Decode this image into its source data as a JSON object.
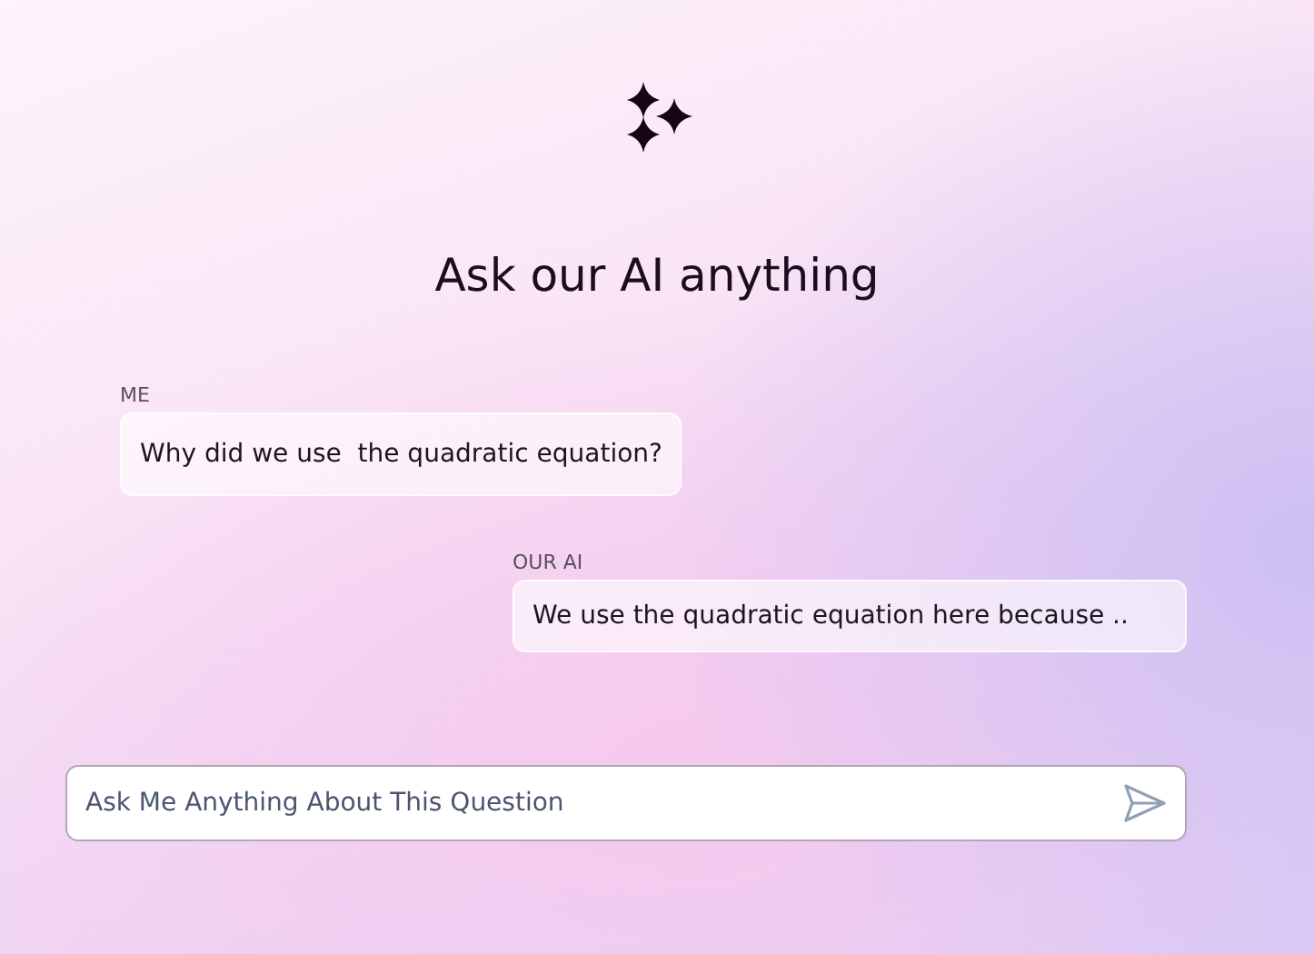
{
  "title": "Ask our AI anything",
  "messages": [
    {
      "kind": "user",
      "sender": "ME",
      "text": "Why did we use  the quadratic equation?"
    },
    {
      "kind": "ai",
      "sender": "OUR AI",
      "text": "We use the quadratic equation here because .."
    }
  ],
  "input": {
    "placeholder": "Ask Me Anything About This Question"
  }
}
